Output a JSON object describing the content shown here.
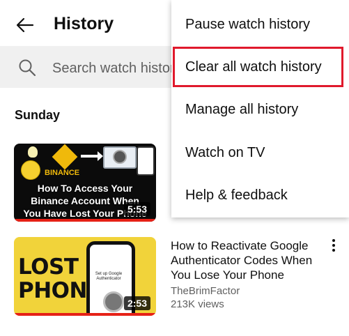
{
  "header": {
    "title": "History"
  },
  "search": {
    "placeholder": "Search watch history"
  },
  "section": {
    "title": "Sunday"
  },
  "videos": [
    {
      "thumbnail_text": {
        "brand": "BINANCE",
        "line1": "How To Access Your",
        "line2": "Binance Account When",
        "line3": "You Have Lost Your Phone"
      },
      "duration": "5:53"
    },
    {
      "thumbnail_text": {
        "line1": "LOST",
        "line2": "PHONE",
        "phone_text": "Set up Google Authenticator"
      },
      "title": "How to Reactivate Google Authenticator Codes When You Lose Your Phone",
      "channel": "TheBrimFactor",
      "views": "213K views",
      "duration": "2:53"
    }
  ],
  "menu": {
    "items": [
      {
        "label": "Pause watch history"
      },
      {
        "label": "Clear all watch history",
        "highlighted": true
      },
      {
        "label": "Manage all history"
      },
      {
        "label": "Watch on TV"
      },
      {
        "label": "Help & feedback"
      }
    ]
  },
  "colors": {
    "highlight_border": "#e0192c",
    "progress_bar": "#e62117",
    "binance_yellow": "#f0b90b"
  },
  "icons": {
    "back": "arrow-left-icon",
    "search": "search-icon",
    "more": "more-vert-icon"
  }
}
